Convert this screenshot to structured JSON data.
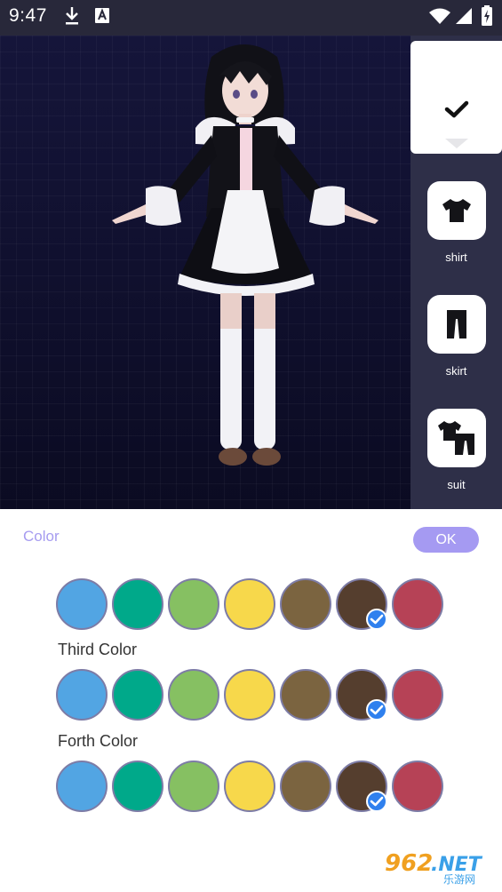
{
  "status_bar": {
    "time": "9:47",
    "icons": [
      "download-icon",
      "font-app-icon",
      "wifi-icon",
      "signal-icon",
      "battery-charging-icon"
    ]
  },
  "viewport": {
    "background_color": "#101028",
    "subject": "character-model"
  },
  "side_panel": {
    "background_color": "#2e2f48",
    "confirm_icon": "check-icon",
    "categories": [
      {
        "label": "shirt",
        "icon": "shirt-icon"
      },
      {
        "label": "skirt",
        "icon": "skirt-icon"
      },
      {
        "label": "suit",
        "icon": "suit-icon"
      }
    ]
  },
  "color_panel": {
    "title": "Color",
    "ok_label": "OK",
    "accent_color": "#a59af2",
    "palette": [
      "#52a5e3",
      "#00a98a",
      "#86c062",
      "#f7d84b",
      "#7b6440",
      "#553e2e",
      "#b64256"
    ],
    "rows": [
      {
        "label": "",
        "selected_index": 5
      },
      {
        "label": "Third Color",
        "selected_index": 5
      },
      {
        "label": "Forth Color",
        "selected_index": 5
      }
    ]
  },
  "watermark": {
    "brand": "962.NET",
    "subtitle": "乐游网"
  }
}
